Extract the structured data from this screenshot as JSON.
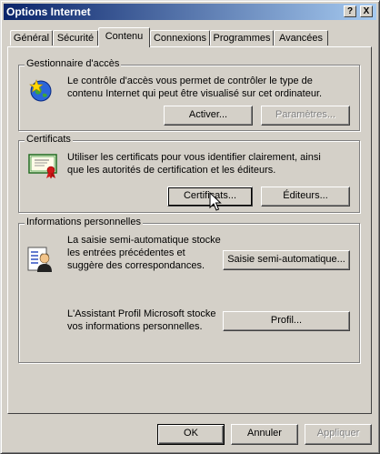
{
  "window": {
    "title": "Options Internet"
  },
  "title_buttons": {
    "help": "?",
    "close": "X"
  },
  "tabs": [
    {
      "label": "Général"
    },
    {
      "label": "Sécurité"
    },
    {
      "label": "Contenu"
    },
    {
      "label": "Connexions"
    },
    {
      "label": "Programmes"
    },
    {
      "label": "Avancées"
    }
  ],
  "access": {
    "title": "Gestionnaire d'accès",
    "desc_l1": "Le contrôle d'accès vous permet de contrôler le type de",
    "desc_l2": "contenu Internet qui peut être visualisé sur cet ordinateur.",
    "enable": "Activer...",
    "settings": "Paramètres..."
  },
  "certs": {
    "title": "Certificats",
    "desc_l1": "Utiliser les certificats pour vous identifier clairement, ainsi",
    "desc_l2": "que les autorités de certification et les éditeurs.",
    "certificates": "Certificats...",
    "publishers": "Éditeurs..."
  },
  "personal": {
    "title": "Informations personnelles",
    "auto_l1": "La saisie semi-automatique stocke",
    "auto_l2": "les entrées précédentes et",
    "auto_l3": "suggère des correspondances.",
    "auto_btn": "Saisie semi-automatique...",
    "prof_l1": "L'Assistant Profil Microsoft stocke",
    "prof_l2": "vos informations personnelles.",
    "prof_btn": "Profil..."
  },
  "footer": {
    "ok": "OK",
    "cancel": "Annuler",
    "apply": "Appliquer"
  }
}
